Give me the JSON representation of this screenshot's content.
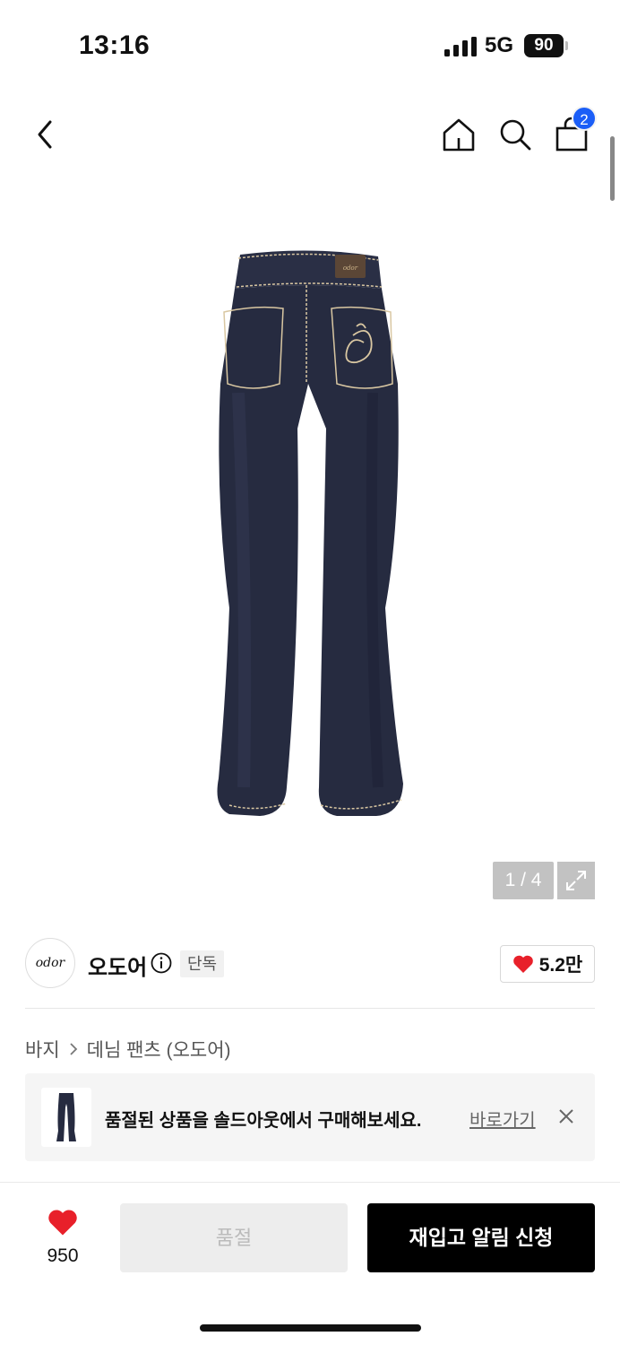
{
  "status_bar": {
    "time": "13:16",
    "network": "5G",
    "battery": "90"
  },
  "nav": {
    "back_icon": "chevron-left-icon",
    "home_icon": "home-icon",
    "search_icon": "search-icon",
    "cart_icon": "shopping-bag-icon",
    "cart_badge": "2"
  },
  "gallery": {
    "page_indicator": "1 / 4",
    "expand_icon": "expand-icon",
    "jeans_logo_text": "odor"
  },
  "brand": {
    "logo_text": "odor",
    "name": "오도어",
    "exclusive_badge": "단독",
    "likes": "5.2만"
  },
  "breadcrumb": {
    "category": "바지",
    "subcategory": "데님 팬츠 (오도어)"
  },
  "soldout_banner": {
    "message": "품절된 상품을 솔드아웃에서 구매해보세요.",
    "link_label": "바로가기"
  },
  "bottom_bar": {
    "wish_count": "950",
    "soldout_label": "품절",
    "restock_label": "재입고 알림 신청"
  },
  "colors": {
    "accent_blue": "#1b5ef7",
    "heart_red": "#e8202a",
    "denim": "#2a2f45",
    "stitch": "#d9c7a2"
  }
}
